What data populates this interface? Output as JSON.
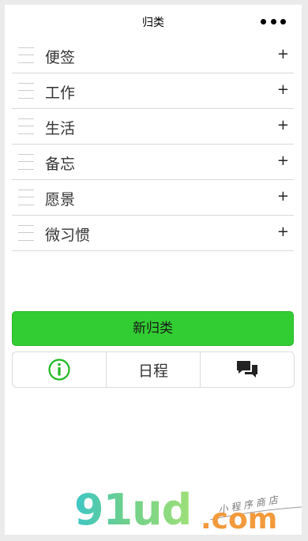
{
  "navbar": {
    "title": "归类"
  },
  "categories": [
    {
      "label": "便签",
      "action": "+"
    },
    {
      "label": "工作",
      "action": "+"
    },
    {
      "label": "生活",
      "action": "+"
    },
    {
      "label": "备忘",
      "action": "+"
    },
    {
      "label": "愿景",
      "action": "+"
    },
    {
      "label": "微习惯",
      "action": "+"
    }
  ],
  "new_category_button": {
    "label": "新归类"
  },
  "tabbar": {
    "info_icon": "info-circle-icon",
    "schedule_label": "日程",
    "chat_icon": "chat-bubbles-icon"
  },
  "watermark": {
    "brand": "91ud",
    "domain": ".com",
    "tagline": "小程序商店"
  },
  "colors": {
    "accent_green": "#32cd32",
    "info_icon_green": "#22b822",
    "watermark_orange": "#f39a3c",
    "watermark_teal": "#3ec6c6"
  }
}
